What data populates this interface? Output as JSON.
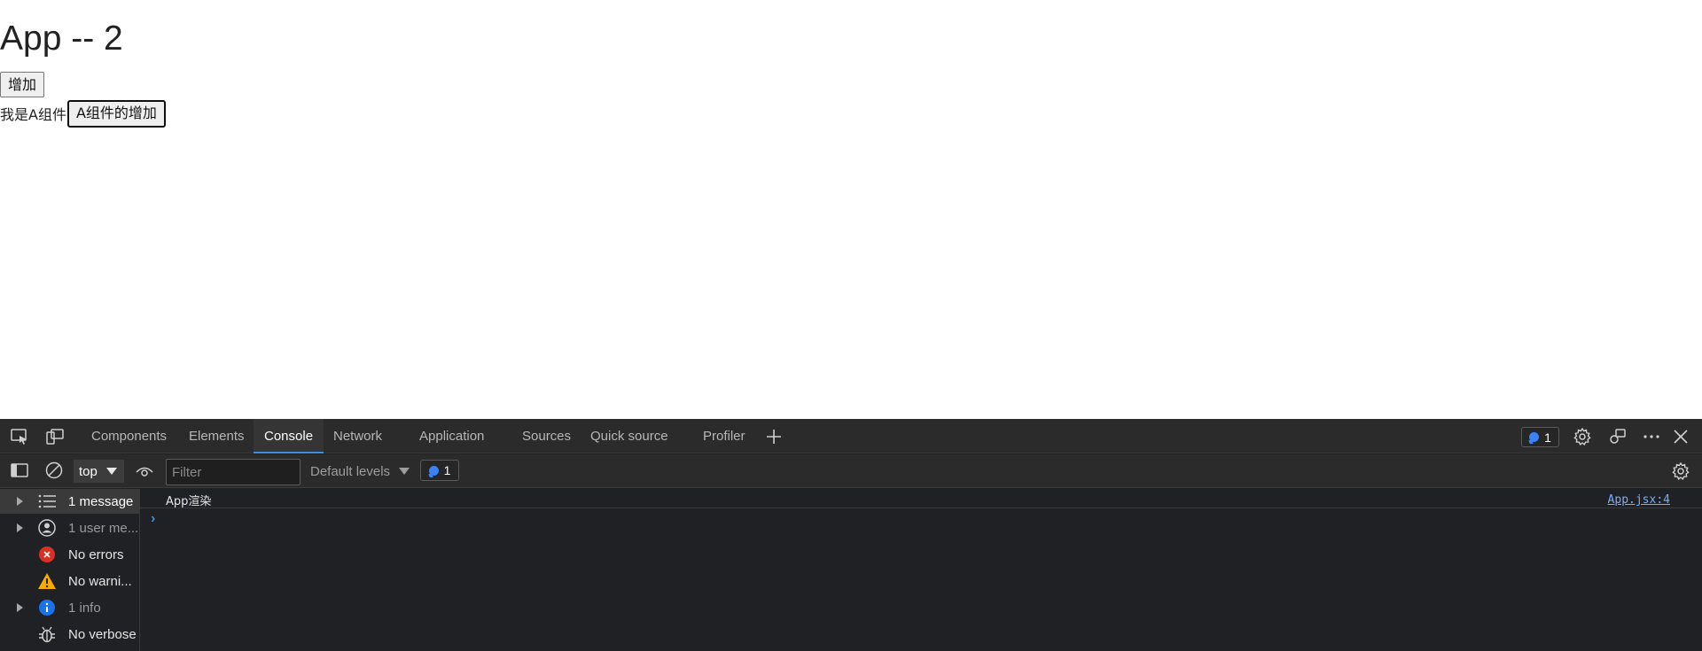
{
  "page": {
    "title": "App -- 2",
    "add_button": "增加",
    "component_a_label": "我是A组件",
    "component_a_button": "A组件的增加"
  },
  "devtools": {
    "tabs": [
      {
        "label": "Components"
      },
      {
        "label": "Elements"
      },
      {
        "label": "Console",
        "active": true
      },
      {
        "label": "Network"
      },
      {
        "label": "Application"
      },
      {
        "label": "Sources"
      },
      {
        "label": "Quick source"
      },
      {
        "label": "Profiler"
      }
    ],
    "issues_badge_count": "1",
    "toolbar": {
      "context": "top",
      "filter_placeholder": "Filter",
      "levels": "Default levels",
      "messages_badge_count": "1"
    },
    "sidebar": {
      "items": [
        {
          "label": "1 message",
          "icon": "list-icon"
        },
        {
          "label": "1 user me...",
          "icon": "user-icon"
        },
        {
          "label": "No errors",
          "icon": "error-icon"
        },
        {
          "label": "No warni...",
          "icon": "warning-icon"
        },
        {
          "label": "1 info",
          "icon": "info-icon"
        },
        {
          "label": "No verbose",
          "icon": "bug-icon"
        }
      ]
    },
    "console": {
      "log_text": "App渲染",
      "log_source": "App.jsx:4"
    },
    "colors": {
      "panel_bg": "#202124",
      "toolbar_bg": "#2b2b2b",
      "accent": "#3b8de0",
      "error": "#d93025",
      "warning": "#f9ab00",
      "info": "#1a73e8"
    }
  }
}
